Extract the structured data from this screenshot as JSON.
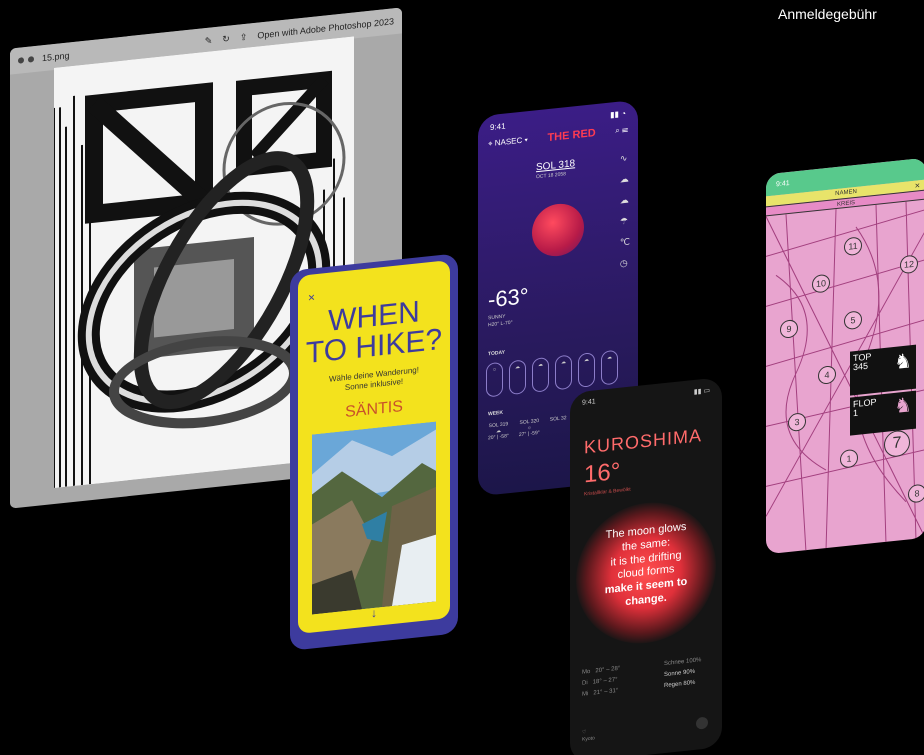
{
  "corner_text": "Anmeldegebühr",
  "photoshop": {
    "filename": "15.png",
    "open_with": "Open with Adobe Photoshop 2023"
  },
  "hike": {
    "close": "×",
    "title_line1": "WHEN",
    "title_line2": "TO HIKE?",
    "subtitle_line1": "Wähle deine Wanderung!",
    "subtitle_line2": "Sonne inklusive!",
    "peak": "SÄNTIS",
    "arrow": "↓",
    "colors": {
      "bg": "#3d3b9e",
      "panel": "#f3e21d",
      "peak": "#c9512a"
    }
  },
  "red": {
    "time": "9:41",
    "location": "NASEC",
    "brand": "THE RED",
    "sol": "SOL 318",
    "sol_date": "OCT 18 2058",
    "temp": "-63°",
    "temp_sub1": "SUNNY",
    "temp_sub2": "H20° L-70°",
    "today_label": "TODAY",
    "week_label": "WEEK",
    "week_days": [
      "SOL 319",
      "SOL 320",
      "SOL 32"
    ],
    "week_temps": [
      "20° | -58°",
      "27° | -59°",
      ""
    ],
    "colors": {
      "brand": "#ff3b52",
      "planet": "#d72a4e"
    }
  },
  "map": {
    "time": "9:41",
    "namen": "NAMEN",
    "kreis": "KREIS",
    "close": "×",
    "numbers": [
      "11",
      "10",
      "12",
      "9",
      "5",
      "4",
      "3",
      "1",
      "7",
      "8"
    ],
    "top": "TOP",
    "top_value": "345",
    "flop": "FLOP",
    "flop_value": "1",
    "colors": {
      "bg": "#e8a4cf",
      "status": "#58c98c",
      "namen": "#e8e46a"
    }
  },
  "kuro": {
    "time": "9:41",
    "name": "KUROSHIMA",
    "deg": "16°",
    "desc": "Kristallklar & Bewölkt",
    "haiku_1": "The moon glows",
    "haiku_2": "the same:",
    "haiku_3": "it is the drifting",
    "haiku_4": "cloud forms",
    "haiku_5": "make it seem to",
    "haiku_6": "change.",
    "days": [
      "Mo",
      "Di",
      "Mi"
    ],
    "ranges": [
      "20° – 28°",
      "18° – 27°",
      "21° – 31°"
    ],
    "conditions": [
      "Schnee",
      "Sonne",
      "Regen"
    ],
    "percents": [
      "100%",
      "90%",
      "80%"
    ],
    "footer": "Kyoto",
    "colors": {
      "accent": "#ff6b6b",
      "glow": "#ff4f4f"
    }
  }
}
